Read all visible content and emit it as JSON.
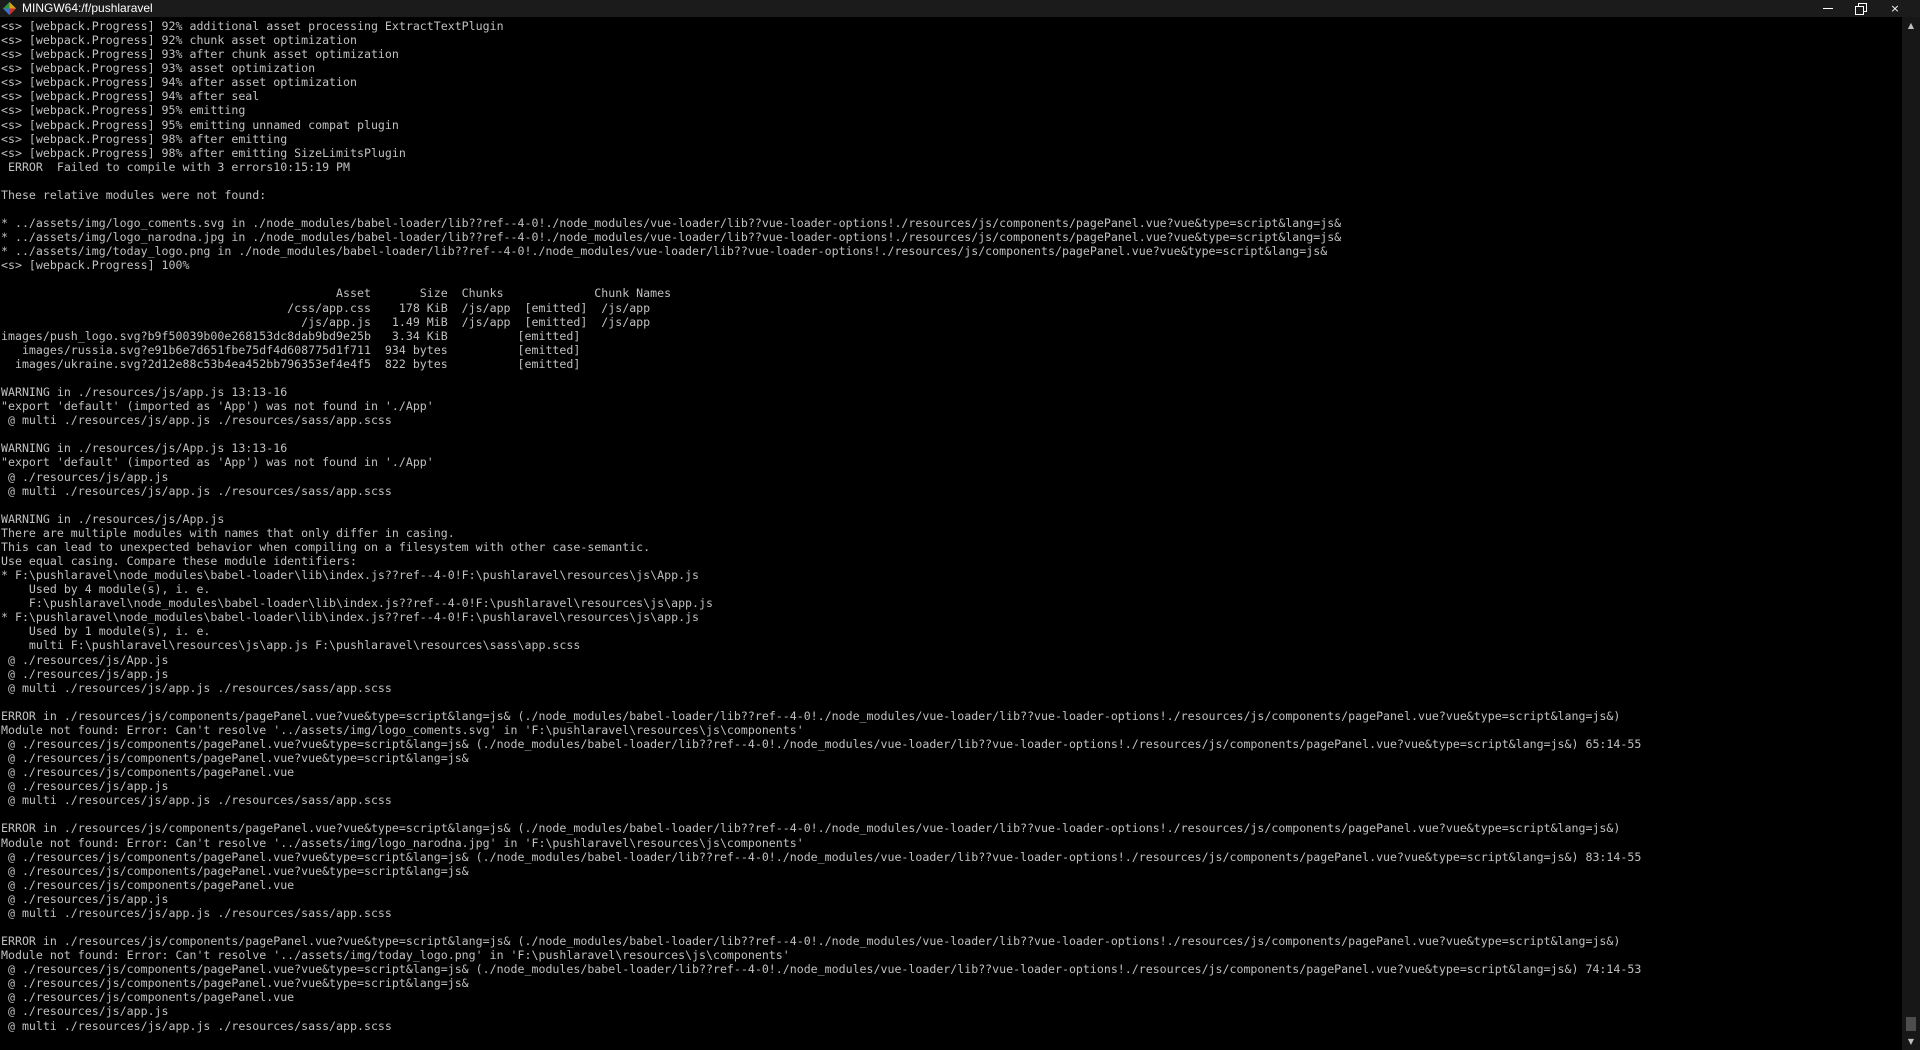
{
  "window": {
    "title": "MINGW64:/f/pushlaravel",
    "controls": {
      "minimize": "minimize-icon",
      "maximize": "restore-icon",
      "close": "×"
    }
  },
  "colors": {
    "background": "#000000",
    "text": "#c0c0c0",
    "titlebar": "#1b1b1b"
  },
  "terminal": {
    "lines": [
      "<s> [webpack.Progress] 92% additional asset processing ExtractTextPlugin",
      "<s> [webpack.Progress] 92% chunk asset optimization",
      "<s> [webpack.Progress] 93% after chunk asset optimization",
      "<s> [webpack.Progress] 93% asset optimization",
      "<s> [webpack.Progress] 94% after asset optimization",
      "<s> [webpack.Progress] 94% after seal",
      "<s> [webpack.Progress] 95% emitting",
      "<s> [webpack.Progress] 95% emitting unnamed compat plugin",
      "<s> [webpack.Progress] 98% after emitting",
      "<s> [webpack.Progress] 98% after emitting SizeLimitsPlugin",
      " ERROR  Failed to compile with 3 errors10:15:19 PM",
      "",
      "These relative modules were not found:",
      "",
      "* ../assets/img/logo_coments.svg in ./node_modules/babel-loader/lib??ref--4-0!./node_modules/vue-loader/lib??vue-loader-options!./resources/js/components/pagePanel.vue?vue&type=script&lang=js&",
      "* ../assets/img/logo_narodna.jpg in ./node_modules/babel-loader/lib??ref--4-0!./node_modules/vue-loader/lib??vue-loader-options!./resources/js/components/pagePanel.vue?vue&type=script&lang=js&",
      "* ../assets/img/today_logo.png in ./node_modules/babel-loader/lib??ref--4-0!./node_modules/vue-loader/lib??vue-loader-options!./resources/js/components/pagePanel.vue?vue&type=script&lang=js&",
      "<s> [webpack.Progress] 100%",
      "",
      "                                                Asset       Size  Chunks             Chunk Names",
      "                                         /css/app.css    178 KiB  /js/app  [emitted]  /js/app",
      "                                           /js/app.js   1.49 MiB  /js/app  [emitted]  /js/app",
      "images/push_logo.svg?b9f50039b00e268153dc8dab9bd9e25b   3.34 KiB          [emitted]",
      "   images/russia.svg?e91b6e7d651fbe75df4d608775d1f711  934 bytes          [emitted]",
      "  images/ukraine.svg?2d12e88c53b4ea452bb796353ef4e4f5  822 bytes          [emitted]",
      "",
      "WARNING in ./resources/js/app.js 13:13-16",
      "\"export 'default' (imported as 'App') was not found in './App'",
      " @ multi ./resources/js/app.js ./resources/sass/app.scss",
      "",
      "WARNING in ./resources/js/App.js 13:13-16",
      "\"export 'default' (imported as 'App') was not found in './App'",
      " @ ./resources/js/app.js",
      " @ multi ./resources/js/app.js ./resources/sass/app.scss",
      "",
      "WARNING in ./resources/js/App.js",
      "There are multiple modules with names that only differ in casing.",
      "This can lead to unexpected behavior when compiling on a filesystem with other case-semantic.",
      "Use equal casing. Compare these module identifiers:",
      "* F:\\pushlaravel\\node_modules\\babel-loader\\lib\\index.js??ref--4-0!F:\\pushlaravel\\resources\\js\\App.js",
      "    Used by 4 module(s), i. e.",
      "    F:\\pushlaravel\\node_modules\\babel-loader\\lib\\index.js??ref--4-0!F:\\pushlaravel\\resources\\js\\app.js",
      "* F:\\pushlaravel\\node_modules\\babel-loader\\lib\\index.js??ref--4-0!F:\\pushlaravel\\resources\\js\\app.js",
      "    Used by 1 module(s), i. e.",
      "    multi F:\\pushlaravel\\resources\\js\\app.js F:\\pushlaravel\\resources\\sass\\app.scss",
      " @ ./resources/js/App.js",
      " @ ./resources/js/app.js",
      " @ multi ./resources/js/app.js ./resources/sass/app.scss",
      "",
      "ERROR in ./resources/js/components/pagePanel.vue?vue&type=script&lang=js& (./node_modules/babel-loader/lib??ref--4-0!./node_modules/vue-loader/lib??vue-loader-options!./resources/js/components/pagePanel.vue?vue&type=script&lang=js&)",
      "Module not found: Error: Can't resolve '../assets/img/logo_coments.svg' in 'F:\\pushlaravel\\resources\\js\\components'",
      " @ ./resources/js/components/pagePanel.vue?vue&type=script&lang=js& (./node_modules/babel-loader/lib??ref--4-0!./node_modules/vue-loader/lib??vue-loader-options!./resources/js/components/pagePanel.vue?vue&type=script&lang=js&) 65:14-55",
      " @ ./resources/js/components/pagePanel.vue?vue&type=script&lang=js&",
      " @ ./resources/js/components/pagePanel.vue",
      " @ ./resources/js/app.js",
      " @ multi ./resources/js/app.js ./resources/sass/app.scss",
      "",
      "ERROR in ./resources/js/components/pagePanel.vue?vue&type=script&lang=js& (./node_modules/babel-loader/lib??ref--4-0!./node_modules/vue-loader/lib??vue-loader-options!./resources/js/components/pagePanel.vue?vue&type=script&lang=js&)",
      "Module not found: Error: Can't resolve '../assets/img/logo_narodna.jpg' in 'F:\\pushlaravel\\resources\\js\\components'",
      " @ ./resources/js/components/pagePanel.vue?vue&type=script&lang=js& (./node_modules/babel-loader/lib??ref--4-0!./node_modules/vue-loader/lib??vue-loader-options!./resources/js/components/pagePanel.vue?vue&type=script&lang=js&) 83:14-55",
      " @ ./resources/js/components/pagePanel.vue?vue&type=script&lang=js&",
      " @ ./resources/js/components/pagePanel.vue",
      " @ ./resources/js/app.js",
      " @ multi ./resources/js/app.js ./resources/sass/app.scss",
      "",
      "ERROR in ./resources/js/components/pagePanel.vue?vue&type=script&lang=js& (./node_modules/babel-loader/lib??ref--4-0!./node_modules/vue-loader/lib??vue-loader-options!./resources/js/components/pagePanel.vue?vue&type=script&lang=js&)",
      "Module not found: Error: Can't resolve '../assets/img/today_logo.png' in 'F:\\pushlaravel\\resources\\js\\components'",
      " @ ./resources/js/components/pagePanel.vue?vue&type=script&lang=js& (./node_modules/babel-loader/lib??ref--4-0!./node_modules/vue-loader/lib??vue-loader-options!./resources/js/components/pagePanel.vue?vue&type=script&lang=js&) 74:14-53",
      " @ ./resources/js/components/pagePanel.vue?vue&type=script&lang=js&",
      " @ ./resources/js/components/pagePanel.vue",
      " @ ./resources/js/app.js",
      " @ multi ./resources/js/app.js ./resources/sass/app.scss"
    ]
  }
}
